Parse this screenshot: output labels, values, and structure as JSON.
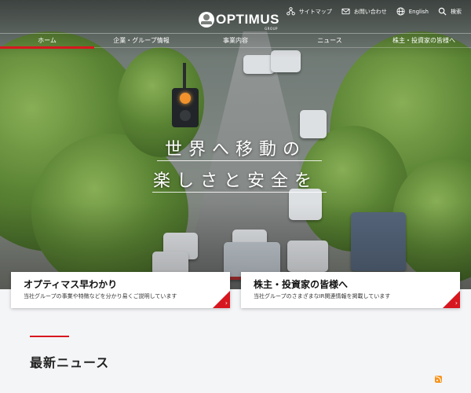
{
  "brand": {
    "name": "OPTIMUS",
    "sub": "GROUP"
  },
  "utility": [
    {
      "label": "サイトマップ",
      "icon": "sitemap-icon"
    },
    {
      "label": "お問い合わせ",
      "icon": "mail-icon"
    },
    {
      "label": "English",
      "icon": "globe-icon"
    },
    {
      "label": "検索",
      "icon": "search-icon"
    }
  ],
  "nav": [
    {
      "label": "ホーム",
      "active": true
    },
    {
      "label": "企業・グループ情報"
    },
    {
      "label": "事業内容"
    },
    {
      "label": "ニュース"
    },
    {
      "label": "株主・投資家の皆様へ"
    }
  ],
  "hero": {
    "line1": "世界へ移動の",
    "line2": "楽しさと安全を"
  },
  "cards": [
    {
      "title": "オプティマス早わかり",
      "desc": "当社グループの事業や特徴などを分かり易くご説明しています"
    },
    {
      "title": "株主・投資家の皆様へ",
      "desc": "当社グループのさまざまなIR関連情報を掲載しています"
    }
  ],
  "news": {
    "title": "最新ニュース"
  },
  "colors": {
    "accent": "#d7171f",
    "rss": "#f7941d"
  }
}
